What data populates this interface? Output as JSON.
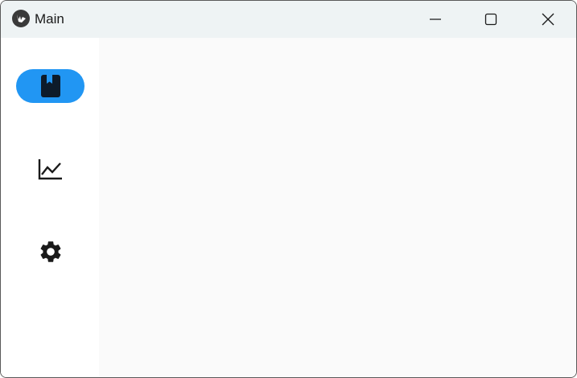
{
  "window": {
    "title": "Main",
    "app_icon": "kivy-logo-icon",
    "controls": {
      "minimize_icon": "minimize-icon",
      "maximize_icon": "maximize-icon",
      "close_icon": "close-icon"
    }
  },
  "navigation_rail": {
    "items": [
      {
        "icon": "book-icon",
        "active": true
      },
      {
        "icon": "chart-line-icon",
        "active": false
      },
      {
        "icon": "gear-icon",
        "active": false
      }
    ]
  },
  "colors": {
    "accent": "#2196f3",
    "titlebar_bg": "#eef3f4",
    "rail_bg": "#ffffff",
    "content_bg": "#fafafa",
    "icon_color": "#1a1a1a"
  }
}
